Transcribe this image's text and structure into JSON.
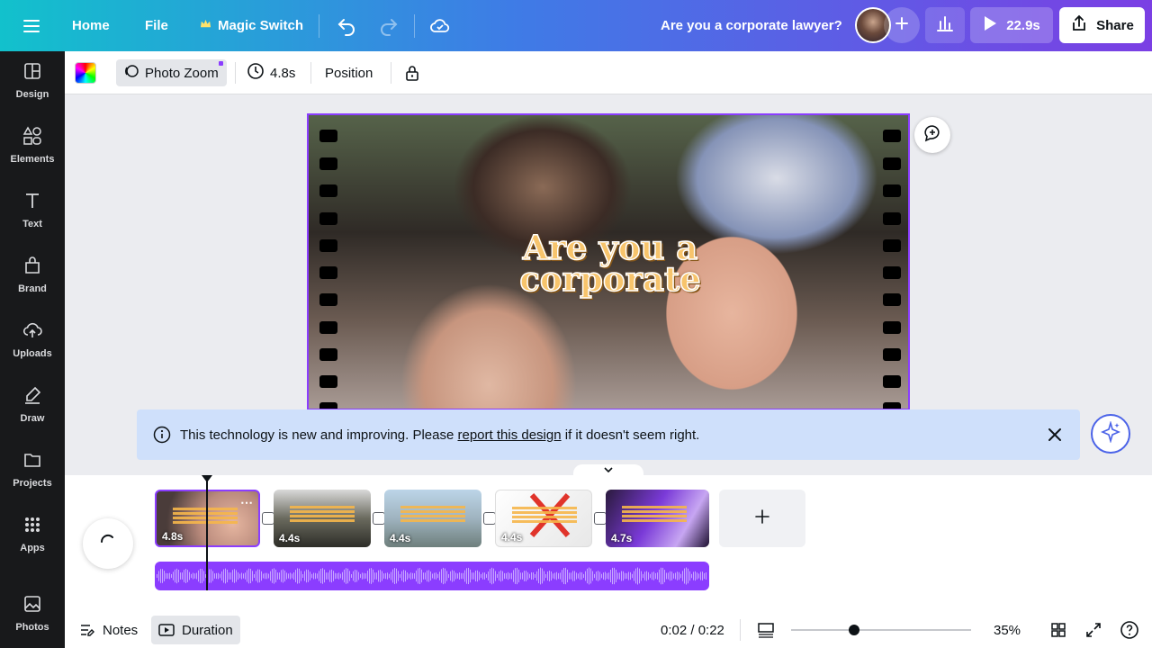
{
  "topbar": {
    "home": "Home",
    "file": "File",
    "magic_switch": "Magic Switch",
    "design_title": "Are you a corporate lawyer?",
    "play_duration": "22.9s",
    "share": "Share"
  },
  "toolbar": {
    "photo_zoom": "Photo Zoom",
    "duration": "4.8s",
    "position": "Position"
  },
  "sidebar": {
    "items": [
      {
        "label": "Design",
        "icon": "design-icon"
      },
      {
        "label": "Elements",
        "icon": "elements-icon"
      },
      {
        "label": "Text",
        "icon": "text-icon"
      },
      {
        "label": "Brand",
        "icon": "brand-icon"
      },
      {
        "label": "Uploads",
        "icon": "uploads-icon"
      },
      {
        "label": "Draw",
        "icon": "draw-icon"
      },
      {
        "label": "Projects",
        "icon": "projects-icon"
      },
      {
        "label": "Apps",
        "icon": "apps-icon"
      },
      {
        "label": "Photos",
        "icon": "photos-icon"
      }
    ]
  },
  "canvas": {
    "overlay_line1": "Are you a",
    "overlay_line2": "corporate"
  },
  "notice": {
    "text_before": "This technology is new and improving. Please ",
    "link": "report this design",
    "text_after": " if it doesn't seem right."
  },
  "timeline": {
    "clips": [
      {
        "duration": "4.8s"
      },
      {
        "duration": "4.4s"
      },
      {
        "duration": "4.4s"
      },
      {
        "duration": "4.4s"
      },
      {
        "duration": "4.7s"
      }
    ]
  },
  "bottombar": {
    "notes": "Notes",
    "duration": "Duration",
    "time": "0:02 / 0:22",
    "zoom": "35%",
    "zoom_level": 0.35
  },
  "colors": {
    "accent": "#8b3dff",
    "sidebar_bg": "#18191b",
    "notice_bg": "#cfe0fb"
  }
}
